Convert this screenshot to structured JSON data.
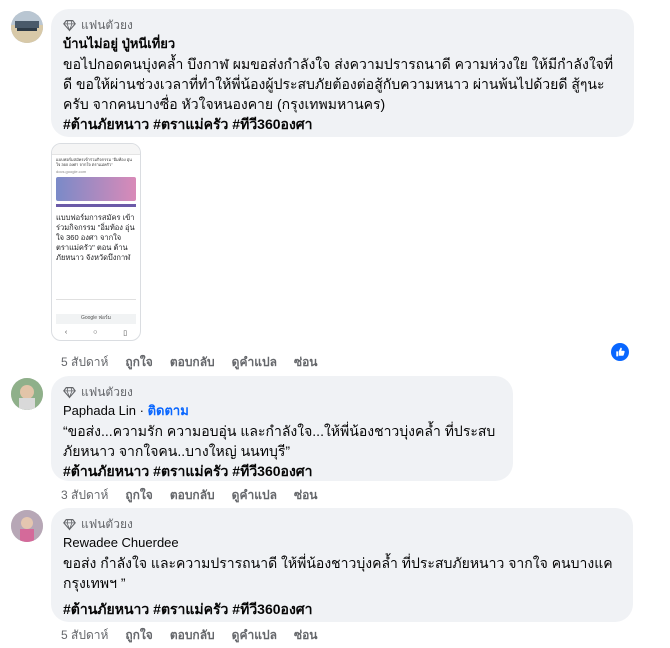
{
  "comments": [
    {
      "badge": "แฟนตัวยง",
      "name": "บ้านไม่อยู่ ปู่หนีเที่ยว",
      "follow": "",
      "text": "ขอไปกอดคนบุ่งคล้ำ บึงกาฬ ผมขอส่งกำลังใจ ส่งความปรารถนาดี ความห่วงใย ให้มีกำลังใจที่ดี ขอให้ผ่านช่วงเวลาที่ทำให้พี่น้องผู้ประสบภัยต้องต่อสู้กับความหนาว ผ่านพ้นไปด้วยดี สู้ๆนะครับ จากคนบางซื่อ หัวใจหนองคาย (กรุงเทพมหานคร)",
      "tags": "#ต้านภัยหนาว #ตราแม่ครัว #ทีวี360องศา",
      "time": "5 สัปดาห์",
      "like": "ถูกใจ",
      "reply": "ตอบกลับ",
      "translate": "ดูคำแปล",
      "hide": "ซ่อน"
    },
    {
      "badge": "แฟนตัวยง",
      "name": "Paphada Lin",
      "follow": "ติดตาม",
      "text": "“ขอส่ง...ความรัก ความอบอุ่น และกำลังใจ...ให้พี่น้องชาวบุ่งคล้ำ ที่ประสบภัยหนาว จากใจคน..บางใหญ่ นนทบุรี”",
      "tags": "#ต้านภัยหนาว #ตราแม่ครัว #ทีวี360องศา",
      "time": "3 สัปดาห์",
      "like": "ถูกใจ",
      "reply": "ตอบกลับ",
      "translate": "ดูคำแปล",
      "hide": "ซ่อน"
    },
    {
      "badge": "แฟนตัวยง",
      "name": "Rewadee Chuerdee",
      "follow": "",
      "text": "ขอส่ง กำลังใจ และความปรารถนาดี ให้พี่น้องชาวบุ่งคล้ำ ที่ประสบภัยหนาว จากใจ คนบางแค กรุงเทพฯ ”",
      "tags": "#ต้านภัยหนาว #ตราแม่ครัว #ทีวี360องศา",
      "time": "5 สัปดาห์",
      "like": "ถูกใจ",
      "reply": "ตอบกลับ",
      "translate": "ดูคำแปล",
      "hide": "ซ่อน"
    }
  ],
  "attachment": {
    "header": "แบบฟอร์มสมัครเข้าร่วมกิจกรรม \"อิ่มท้อง อุ่นใจ 360 องศา จากใจ ตราแม่ครัว\"",
    "url": "docs.google.com",
    "form_title": "แบบฟอร์มการสมัคร เข้าร่วมกิจกรรม \"อิ่มท้อง อุ่นใจ 360 องศา จากใจ ตราแม่ครัว\" ตอน ต้านภัยหนาว จังหวัดบึงกาฬ",
    "footer": "Google ฟอร์ม"
  },
  "colors": {
    "link": "#0866ff",
    "bubble": "#f0f2f5",
    "muted": "#65676b"
  }
}
